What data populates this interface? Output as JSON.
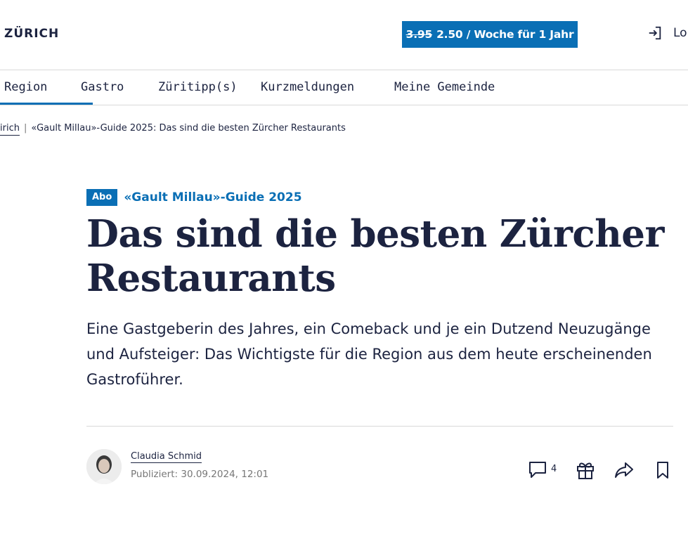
{
  "header": {
    "brand": "ZÜRICH",
    "promo": {
      "old_price": "3.95",
      "new_offer": "2.50 / Woche für 1 Jahr"
    },
    "login_label": "Lo"
  },
  "nav": {
    "items": [
      {
        "label": "Region",
        "active": true
      },
      {
        "label": "Gastro",
        "active": false
      },
      {
        "label": "Züritipp(s)",
        "active": false
      },
      {
        "label": "Kurzmeldungen",
        "active": false
      },
      {
        "label": "Meine Gemeinde",
        "active": false
      }
    ]
  },
  "breadcrumb": {
    "parent": "irich",
    "separator": "|",
    "current": "«Gault Millau»-Guide 2025: Das sind die besten Zürcher Restaurants"
  },
  "article": {
    "badge": "Abo",
    "kicker": "«Gault Millau»-Guide 2025",
    "headline_line1": "Das sind die besten Zürcher",
    "headline_line2": "Restaurants",
    "lead": "Eine Gastgeberin des Jahres, ein Comeback und je ein Dutzend Neuzugänge und Aufsteiger: Das Wichtigste für die Region aus dem heute erscheinenden Gastroführer.",
    "author": "Claudia Schmid",
    "published": "Publiziert: 30.09.2024, 12:01",
    "comment_count": "4"
  },
  "icons": {
    "login": "login-icon",
    "comments": "comment-icon",
    "gift": "gift-icon",
    "share": "share-icon",
    "bookmark": "bookmark-icon"
  },
  "colors": {
    "accent": "#0a6fb5",
    "text": "#1c2340",
    "muted": "#777777",
    "divider": "#d9d9d9"
  }
}
